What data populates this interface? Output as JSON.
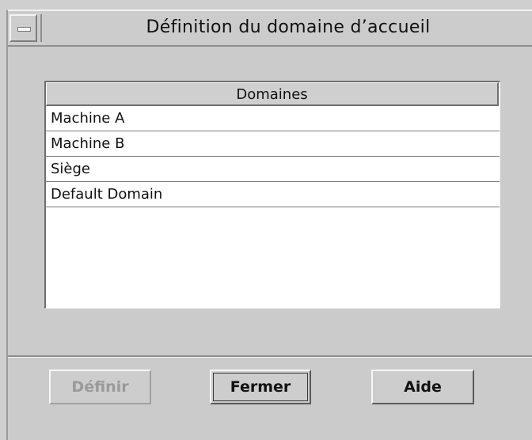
{
  "window": {
    "title": "Définition du domaine d’accueil"
  },
  "table": {
    "column_header": "Domaines",
    "rows": [
      "Machine A",
      "Machine B",
      "Siège",
      "Default Domain"
    ]
  },
  "buttons": {
    "define_label": "Définir",
    "define_enabled": false,
    "close_label": "Fermer",
    "help_label": "Aide"
  },
  "icons": {
    "window_menu": "window-menu-icon"
  }
}
